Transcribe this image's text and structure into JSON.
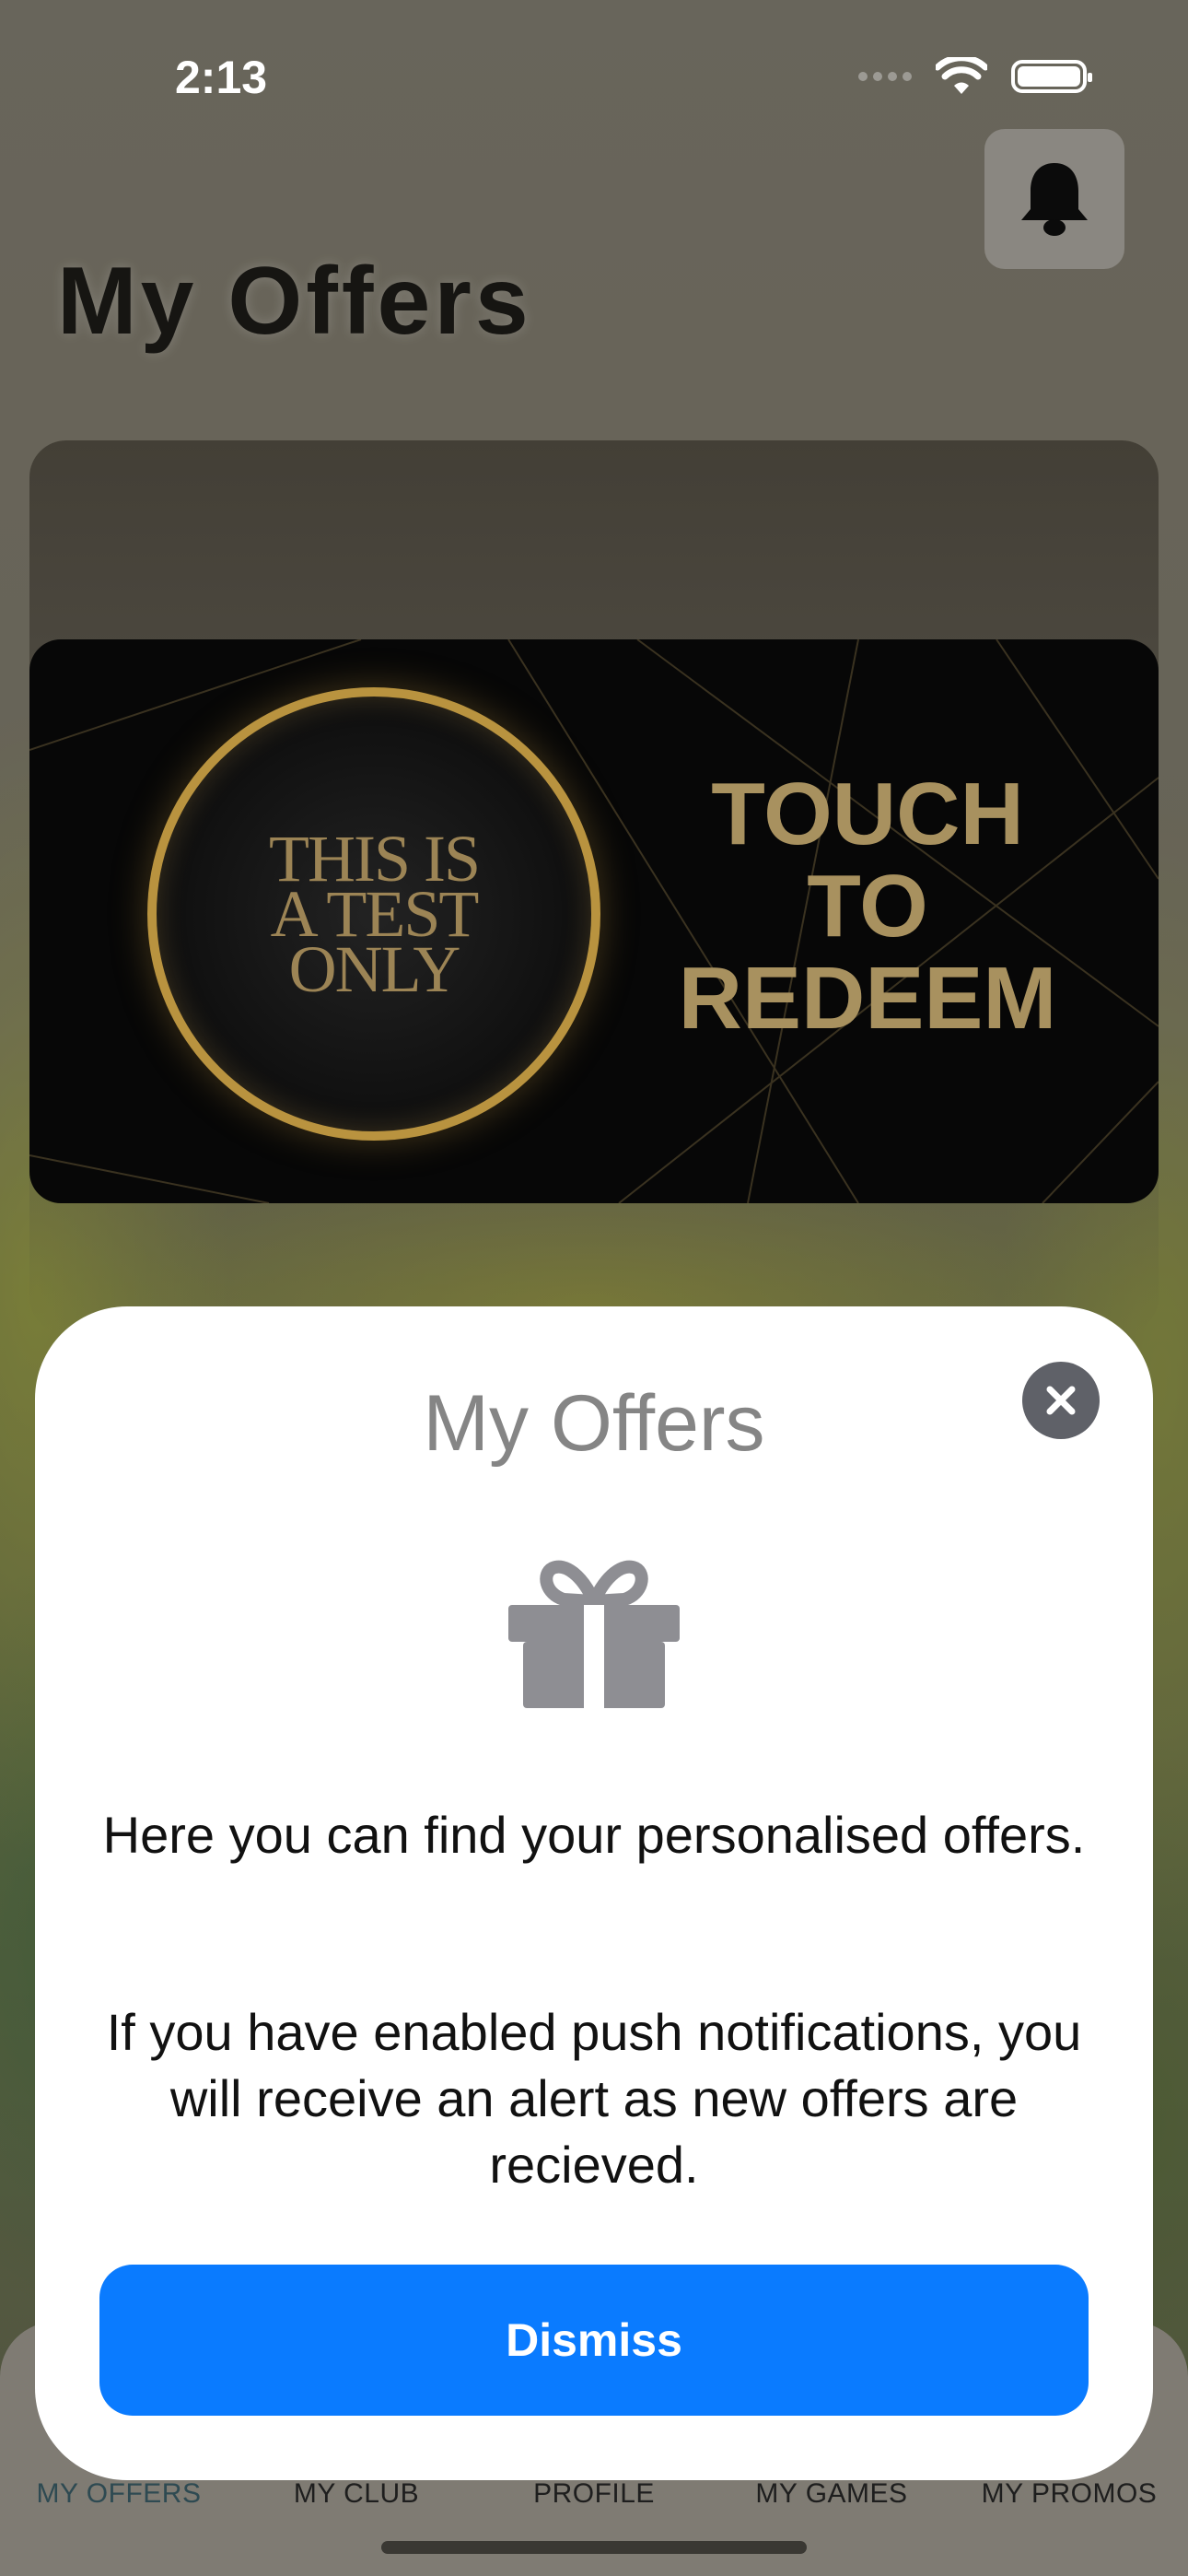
{
  "status_bar": {
    "time": "2:13"
  },
  "header": {
    "title": "My Offers"
  },
  "offer": {
    "ring_text_lines": [
      "THIS IS",
      "A TEST",
      "ONLY"
    ],
    "cta_lines": [
      "TOUCH",
      "TO",
      "REDEEM"
    ]
  },
  "modal": {
    "title": "My Offers",
    "paragraph1": "Here you can find your personalised offers.",
    "paragraph2": "If you have enabled push notifications, you will receive an alert as new offers are recieved.",
    "dismiss_label": "Dismiss"
  },
  "tabs": [
    {
      "label": "MY OFFERS"
    },
    {
      "label": "MY CLUB"
    },
    {
      "label": "PROFILE"
    },
    {
      "label": "MY GAMES"
    },
    {
      "label": "MY PROMOS"
    }
  ],
  "colors": {
    "primary_button": "#0a7bff",
    "offer_gold": "#b9933f"
  },
  "icons": [
    "bell-icon",
    "close-icon",
    "gift-icon",
    "wifi-icon",
    "battery-icon"
  ]
}
